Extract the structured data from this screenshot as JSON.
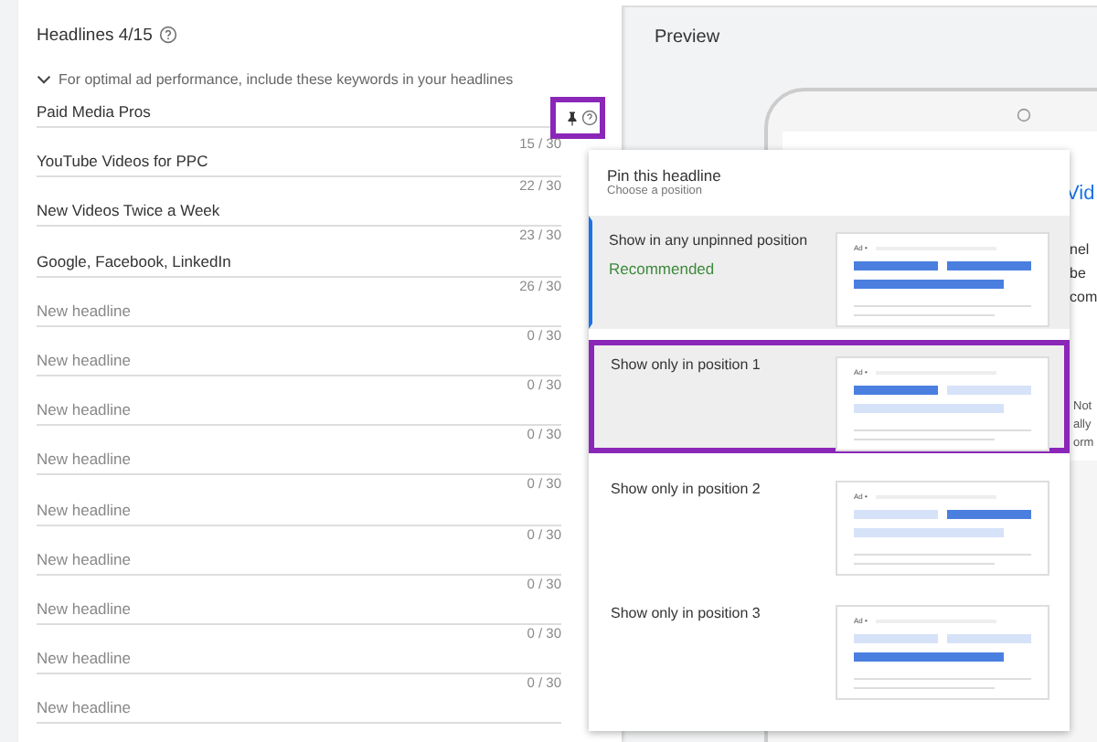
{
  "headlines": {
    "title": "Headlines 4/15",
    "pin_highlighted": true,
    "hint": "For optimal ad performance, include these keywords in your headlines",
    "fields": [
      {
        "value": "Paid Media Pros",
        "counter": "15 / 30"
      },
      {
        "value": "YouTube Videos for PPC",
        "counter": "22 / 30"
      },
      {
        "value": "New Videos Twice a Week",
        "counter": "23 / 30"
      },
      {
        "value": "Google, Facebook, LinkedIn",
        "counter": "26 / 30"
      },
      {
        "placeholder": "New headline",
        "counter": "0 / 30"
      },
      {
        "placeholder": "New headline",
        "counter": "0 / 30"
      },
      {
        "placeholder": "New headline",
        "counter": "0 / 30"
      },
      {
        "placeholder": "New headline",
        "counter": "0 / 30"
      },
      {
        "placeholder": "New headline",
        "counter": "0 / 30"
      },
      {
        "placeholder": "New headline",
        "counter": "0 / 30"
      },
      {
        "placeholder": "New headline",
        "counter": "0 / 30"
      },
      {
        "placeholder": "New headline",
        "counter": "0 / 30"
      },
      {
        "placeholder": "New headline"
      }
    ]
  },
  "preview": {
    "title": "Preview",
    "headline_fragment": "Vid",
    "body_fragments": [
      "nel",
      "be",
      "com"
    ],
    "note_fragments": [
      "Not",
      "ally",
      "orm"
    ]
  },
  "pin_menu": {
    "title": "Pin this headline",
    "subtitle": "Choose a position",
    "options": [
      {
        "label": "Show in any unpinned position",
        "note": "Recommended",
        "selected": true,
        "highlighted": false,
        "ad_label": "Ad •",
        "bars": [
          true,
          true,
          true
        ]
      },
      {
        "label": "Show only in position 1",
        "selected": false,
        "highlighted": true,
        "ad_label": "Ad •",
        "bars": [
          true,
          false,
          false
        ]
      },
      {
        "label": "Show only in position 2",
        "selected": false,
        "highlighted": false,
        "ad_label": "Ad •",
        "bars": [
          false,
          true,
          false
        ]
      },
      {
        "label": "Show only in position 3",
        "selected": false,
        "highlighted": false,
        "ad_label": "Ad •",
        "bars": [
          false,
          false,
          true
        ]
      }
    ]
  }
}
